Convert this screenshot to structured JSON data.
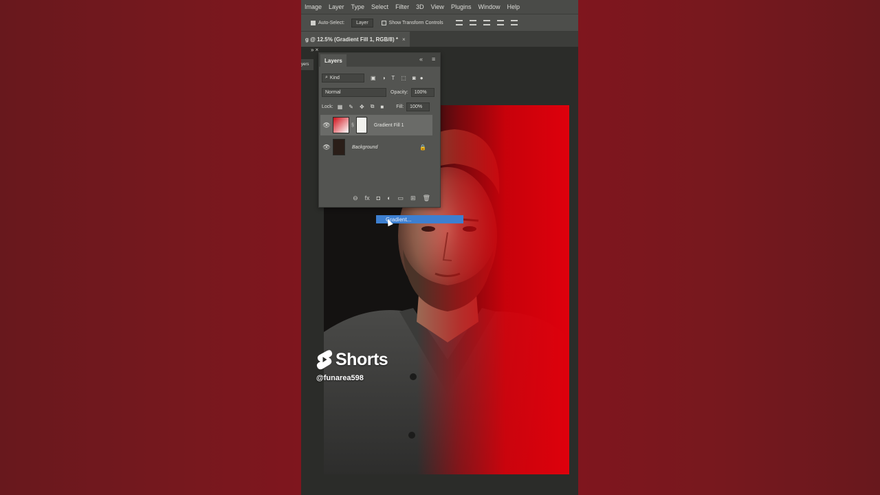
{
  "menu": {
    "items": [
      "Image",
      "Layer",
      "Type",
      "Select",
      "Filter",
      "3D",
      "View",
      "Plugins",
      "Window",
      "Help"
    ]
  },
  "options_bar": {
    "auto_select_label": "Auto-Select:",
    "layer_select_value": "Layer",
    "transform_controls_label": "Show Transform Controls"
  },
  "document_tab": {
    "title": "g @ 12.5% (Gradient Fill 1, RGB/8) *",
    "close": "×"
  },
  "mini_panel": {
    "label": "yers"
  },
  "layers_panel": {
    "tab_label": "Layers",
    "filter_kind": "Kind",
    "blend_mode": "Normal",
    "opacity_label": "Opacity:",
    "opacity_value": "100%",
    "lock_label": "Lock:",
    "fill_label": "Fill:",
    "fill_value": "100%",
    "layers": [
      {
        "name": "Gradient Fill 1",
        "selected": true
      },
      {
        "name": "Background",
        "selected": false,
        "locked": true
      }
    ]
  },
  "context_menu": {
    "item": "Gradient..."
  },
  "watermark": {
    "brand": "Shorts",
    "channel": "@funarea598"
  },
  "colors": {
    "background": "#861820",
    "gradient_red": "#de000c",
    "selection_blue": "#3d7fd0",
    "ps_panel": "#535451"
  }
}
